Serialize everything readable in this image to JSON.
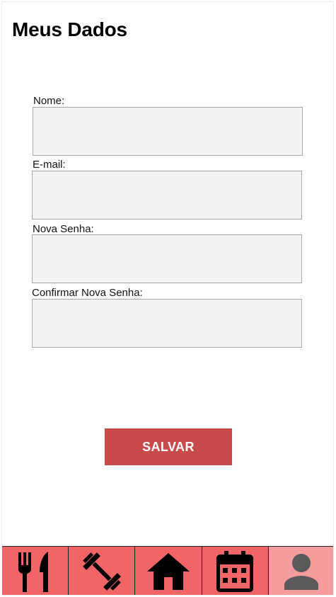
{
  "header": {
    "title": "Meus Dados"
  },
  "form": {
    "fields": [
      {
        "label": "Nome:",
        "value": "",
        "placeholder": ""
      },
      {
        "label": "E-mail:",
        "value": "",
        "placeholder": ""
      },
      {
        "label": "Nova Senha:",
        "value": "",
        "placeholder": ""
      },
      {
        "label": "Confirmar Nova Senha:",
        "value": "",
        "placeholder": ""
      }
    ],
    "save_label": "SALVAR"
  },
  "nav": {
    "items": [
      {
        "icon": "utensils-icon",
        "active": false
      },
      {
        "icon": "dumbbell-icon",
        "active": false
      },
      {
        "icon": "home-icon",
        "active": false
      },
      {
        "icon": "calendar-icon",
        "active": false
      },
      {
        "icon": "user-icon",
        "active": true
      }
    ]
  },
  "colors": {
    "accent": "#c84b4b",
    "nav_background": "#f26566",
    "nav_active_background": "#f59c9c",
    "input_background": "#f3f3f3",
    "input_border": "#a8a8a8"
  }
}
